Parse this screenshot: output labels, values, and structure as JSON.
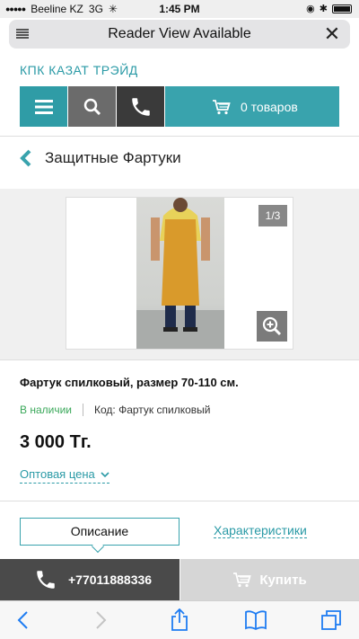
{
  "status_bar": {
    "carrier": "Beeline KZ",
    "network": "3G",
    "time": "1:45 PM"
  },
  "browser": {
    "reader_label": "Reader View Available"
  },
  "site": {
    "brand": "КПК КАЗАТ ТРЭЙД",
    "cart_label": "0 товаров"
  },
  "breadcrumb": {
    "label": "Защитные Фартуки"
  },
  "gallery": {
    "counter": "1/3"
  },
  "product": {
    "title": "Фартук спилковый, размер 70-110 см.",
    "stock": "В наличии",
    "code": "Код: Фартук спилковый",
    "price": "3 000 Тг.",
    "wholesale_label": "Оптовая цена"
  },
  "tabs": {
    "description": "Описание",
    "characteristics": "Характеристики"
  },
  "actions": {
    "phone": "+77011888336",
    "buy": "Купить"
  },
  "colors": {
    "accent": "#39a3ad",
    "dark": "#3a3a3a",
    "stock_green": "#3aa85a"
  }
}
